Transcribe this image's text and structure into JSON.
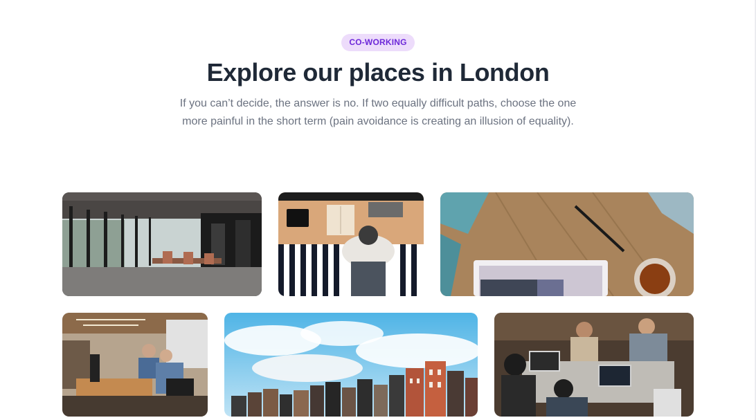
{
  "section": {
    "badge": "CO-WORKING",
    "title": "Explore our places in London",
    "description": "If you can’t decide, the answer is no. If two equally difficult paths, choose the one more painful in the short term (pain avoidance is creating an illusion of equality)."
  },
  "gallery": {
    "images": [
      {
        "name": "office-interior-photo"
      },
      {
        "name": "laptop-desk-topdown-photo"
      },
      {
        "name": "wooden-desk-laptop-tea-photo"
      },
      {
        "name": "coworking-team-photo"
      },
      {
        "name": "amsterdam-houses-sky-photo"
      },
      {
        "name": "people-working-laptops-photo"
      }
    ]
  }
}
